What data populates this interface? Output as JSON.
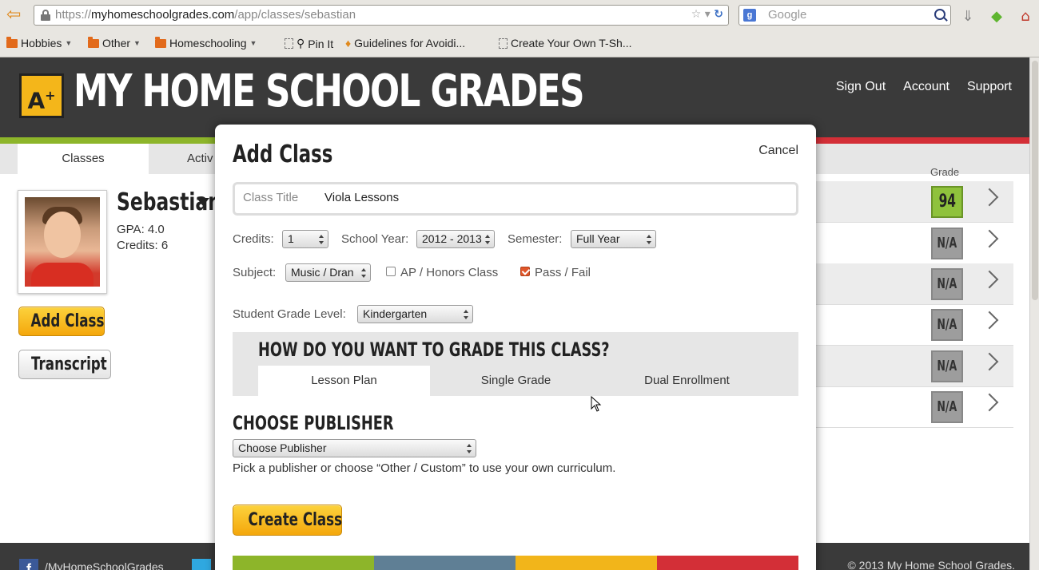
{
  "browser": {
    "url_prefix": "https://",
    "url_domain": "myhomeschoolgrades.com",
    "url_path": "/app/classes/sebastian",
    "search_placeholder": "Google",
    "bookmarks": [
      {
        "label": "Hobbies",
        "type": "folder"
      },
      {
        "label": "Other",
        "type": "folder"
      },
      {
        "label": "Homeschooling",
        "type": "folder"
      },
      {
        "label": "Pin It",
        "type": "page"
      },
      {
        "label": "Guidelines for Avoidi...",
        "type": "page"
      },
      {
        "label": "Create Your Own T-Sh...",
        "type": "page"
      }
    ]
  },
  "site": {
    "logo": "A",
    "logo_sup": "+",
    "title": "MY HOME SCHOOL GRADES",
    "nav": [
      "Sign Out",
      "Account",
      "Support"
    ],
    "stripe_colors": [
      "#8db52a",
      "#5f7f95",
      "#f2b51a",
      "#d32f37"
    ]
  },
  "tabs": [
    "Classes",
    "Activ"
  ],
  "student": {
    "name": "Sebastian",
    "gpa": "GPA: 4.0",
    "credits": "Credits: 6",
    "add_class": "Add Class",
    "transcript": "Transcript"
  },
  "grades": {
    "header": "Grade",
    "rows": [
      "94",
      "N/A",
      "N/A",
      "N/A",
      "N/A",
      "N/A"
    ]
  },
  "footer": {
    "facebook": "/MyHomeSchoolGrades",
    "copyright": "© 2013 My Home School Grades."
  },
  "modal": {
    "title": "Add Class",
    "cancel": "Cancel",
    "class_title_label": "Class Title",
    "class_title_value": "Viola Lessons",
    "credits_label": "Credits:",
    "credits_value": "1",
    "school_year_label": "School Year:",
    "school_year_value": "2012 - 2013",
    "semester_label": "Semester:",
    "semester_value": "Full Year",
    "subject_label": "Subject:",
    "subject_value": "Music / Dran",
    "ap_label": "AP / Honors Class",
    "ap_checked": false,
    "pass_fail_label": "Pass / Fail",
    "pass_fail_checked": true,
    "grade_level_label": "Student Grade Level:",
    "grade_level_value": "Kindergarten",
    "grade_heading": "HOW DO YOU WANT TO GRADE THIS CLASS?",
    "grade_tabs": [
      "Lesson Plan",
      "Single Grade",
      "Dual Enrollment"
    ],
    "publisher_heading": "CHOOSE PUBLISHER",
    "publisher_value": "Choose Publisher",
    "publisher_hint": "Pick a publisher or choose “Other / Custom” to use your own curriculum.",
    "create_button": "Create Class"
  }
}
